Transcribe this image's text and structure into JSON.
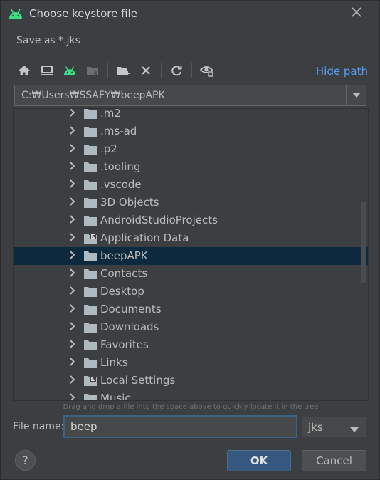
{
  "dialog": {
    "title": "Choose keystore file",
    "subtitle": "Save as *.jks",
    "close_icon": "close-icon"
  },
  "toolbar": {
    "buttons": [
      "home-icon",
      "desktop-icon",
      "android-icon",
      "module-icon",
      "new-folder-icon",
      "delete-icon",
      "refresh-icon",
      "show-hidden-icon"
    ],
    "hide_path_label": "Hide path"
  },
  "path": {
    "value": "C:₩Users₩SSAFY₩beepAPK"
  },
  "tree": {
    "items": [
      {
        "label": ".m2",
        "shortcut": false,
        "selected": false
      },
      {
        "label": ".ms-ad",
        "shortcut": false,
        "selected": false
      },
      {
        "label": ".p2",
        "shortcut": false,
        "selected": false
      },
      {
        "label": ".tooling",
        "shortcut": false,
        "selected": false
      },
      {
        "label": ".vscode",
        "shortcut": false,
        "selected": false
      },
      {
        "label": "3D Objects",
        "shortcut": false,
        "selected": false
      },
      {
        "label": "AndroidStudioProjects",
        "shortcut": false,
        "selected": false
      },
      {
        "label": "Application Data",
        "shortcut": true,
        "selected": false
      },
      {
        "label": "beepAPK",
        "shortcut": false,
        "selected": true
      },
      {
        "label": "Contacts",
        "shortcut": false,
        "selected": false
      },
      {
        "label": "Desktop",
        "shortcut": false,
        "selected": false
      },
      {
        "label": "Documents",
        "shortcut": false,
        "selected": false
      },
      {
        "label": "Downloads",
        "shortcut": false,
        "selected": false
      },
      {
        "label": "Favorites",
        "shortcut": false,
        "selected": false
      },
      {
        "label": "Links",
        "shortcut": false,
        "selected": false
      },
      {
        "label": "Local Settings",
        "shortcut": true,
        "selected": false
      },
      {
        "label": "Music",
        "shortcut": false,
        "selected": false
      }
    ]
  },
  "hint": "Drag and drop a file into the space above to quickly locate it in the tree",
  "filename": {
    "label": "File name:",
    "value": "beep",
    "extension": "jks"
  },
  "buttons": {
    "help": "?",
    "ok": "OK",
    "cancel": "Cancel"
  },
  "colors": {
    "background": "#3c3f41",
    "selection": "#0d293e",
    "accent_link": "#589df6",
    "android_green": "#3ddc84",
    "ok_button": "#365880"
  }
}
